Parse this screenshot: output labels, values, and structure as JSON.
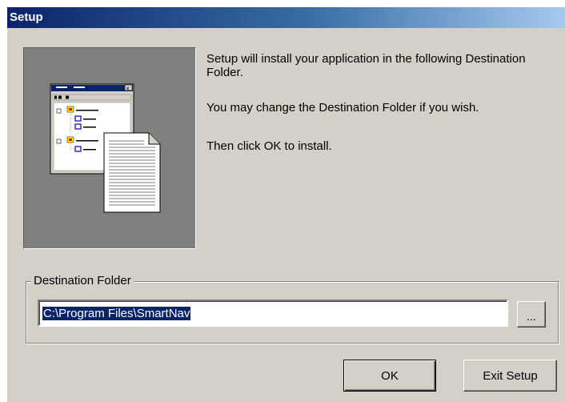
{
  "window": {
    "title": "Setup"
  },
  "messages": {
    "line1": "Setup will install your application in the following Destination Folder.",
    "line2": "You may change the Destination Folder if you wish.",
    "line3": "Then click OK to install."
  },
  "destination": {
    "group_label": "Destination Folder",
    "path_value": "C:\\Program Files\\SmartNav",
    "browse_label": "..."
  },
  "buttons": {
    "ok_label": "OK",
    "exit_label": "Exit Setup"
  },
  "colors": {
    "face": "#d4d0c8",
    "title_start": "#0a246a",
    "title_end": "#a6caf0",
    "selection": "#0a246a",
    "panel": "#808080"
  },
  "icons": {
    "illustration": "setup-window-document-illustration"
  }
}
